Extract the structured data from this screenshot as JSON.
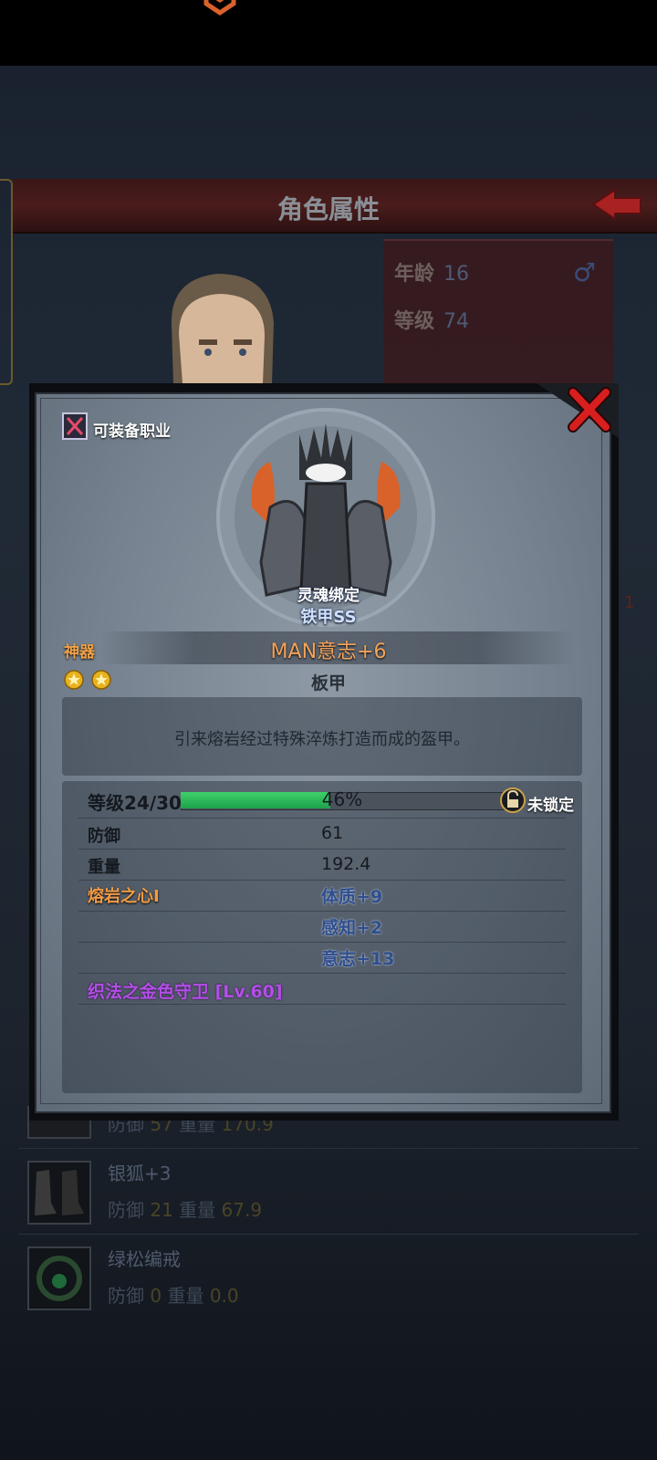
{
  "background": {
    "title": "角色属性",
    "stats": [
      {
        "label": "年龄",
        "value": "16"
      },
      {
        "label": "等级",
        "value": "74"
      }
    ],
    "gender_symbol": "♂",
    "side_number": "1",
    "items": [
      {
        "name": "",
        "defense_label": "防御",
        "defense": "57",
        "weight_label": "重量",
        "weight": "170.9"
      },
      {
        "name": "银狐+3",
        "defense_label": "防御",
        "defense": "21",
        "weight_label": "重量",
        "weight": "67.9"
      },
      {
        "name": "绿松编戒",
        "defense_label": "防御",
        "defense": "0",
        "weight_label": "重量",
        "weight": "0.0"
      }
    ]
  },
  "dialog": {
    "job_label": "可装备职业",
    "soulbound": "灵魂绑定",
    "rank": "铁甲SS",
    "artifact_label": "神器",
    "item_name": "MAN意志+6",
    "item_type": "板甲",
    "star_count": 2,
    "description": "引来熔岩经过特殊淬炼打造而成的盔甲。",
    "level_label": "等级24/30",
    "level_progress": 0.46,
    "level_percent": "46%",
    "lock_label": "未锁定",
    "stats": [
      {
        "label": "防御",
        "value": "61"
      },
      {
        "label": "重量",
        "value": "192.4"
      }
    ],
    "affix_name": "熔岩之心I",
    "affix_bonuses": [
      "体质+9",
      "感知+2",
      "意志+13"
    ],
    "set_name": "织法之金色守卫 [Lv.60]"
  },
  "colors": {
    "accent_orange": "#f19a45",
    "bonus_blue": "#2f4e8c",
    "set_purple": "#b34ee8",
    "xp_green": "#2fb85a",
    "close_red": "#d81e1e"
  }
}
